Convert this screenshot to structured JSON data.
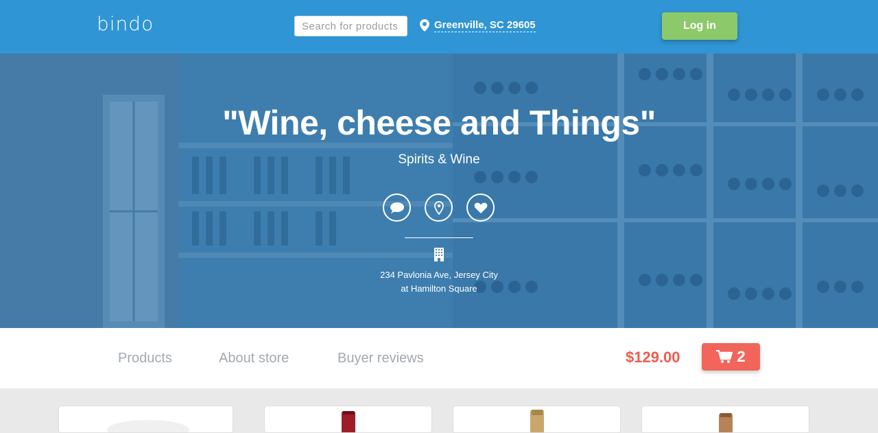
{
  "header": {
    "logo": "bindo",
    "search_placeholder": "Search for products",
    "location": "Greenville, SC 29605",
    "login_label": "Log in"
  },
  "hero": {
    "title": "\"Wine, cheese and Things\"",
    "category": "Spirits & Wine",
    "actions": [
      {
        "icon": "chat-bubble-icon"
      },
      {
        "icon": "map-pin-icon"
      },
      {
        "icon": "heart-icon"
      }
    ],
    "address_line1": "234 Pavlonia Ave, Jersey City",
    "address_line2": "at Hamilton Square"
  },
  "nav": {
    "items": [
      "Products",
      "About store",
      "Buyer reviews"
    ],
    "total": "$129.00",
    "cart_count": "2"
  },
  "colors": {
    "header_blue": "#2f95d4",
    "login_green": "#8cc96b",
    "price_red": "#f05a4f",
    "cart_red": "#f1655b",
    "nav_text": "#a2a9b0"
  }
}
